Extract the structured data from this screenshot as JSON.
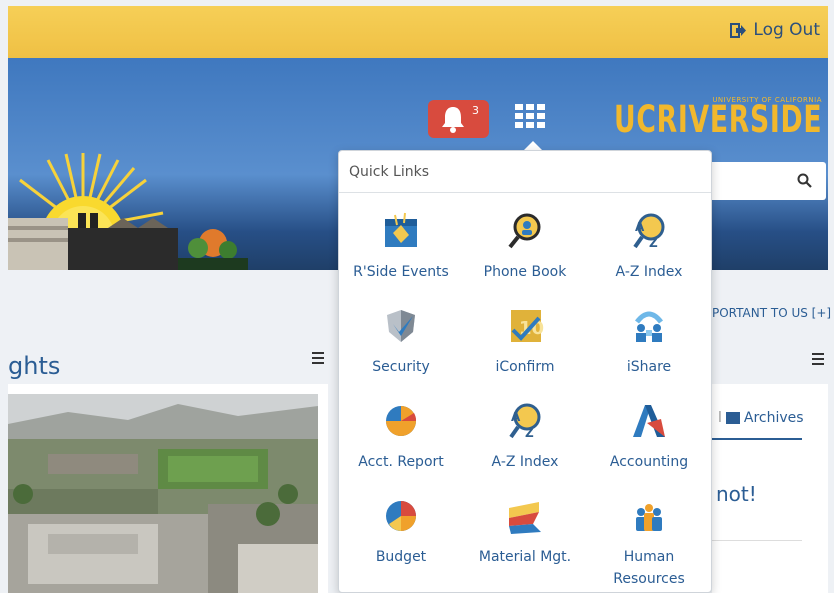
{
  "header": {
    "logout_label": "Log Out",
    "notification_count": "3"
  },
  "logo": {
    "main": "UCRIVERSIDE",
    "sub": "UNIVERSITY OF CALIFORNIA"
  },
  "quick_links": {
    "title": "Quick Links",
    "items": [
      {
        "label": "R'Side Events",
        "icon": "calendar-events-icon"
      },
      {
        "label": "Phone Book",
        "icon": "phone-book-icon"
      },
      {
        "label": "A-Z Index",
        "icon": "az-index-icon"
      },
      {
        "label": "Security",
        "icon": "shield-icon"
      },
      {
        "label": "iConfirm",
        "icon": "iconfirm-icon"
      },
      {
        "label": "iShare",
        "icon": "ishare-icon"
      },
      {
        "label": "Acct. Report",
        "icon": "pie-chart-icon"
      },
      {
        "label": "A-Z Index",
        "icon": "az-index-icon"
      },
      {
        "label": "Accounting",
        "icon": "accounting-icon"
      },
      {
        "label": "Budget",
        "icon": "budget-pie-icon"
      },
      {
        "label": "Material Mgt.",
        "icon": "material-mgt-icon"
      },
      {
        "label": "Human\nResources",
        "icon": "people-icon"
      }
    ]
  },
  "main": {
    "highlights_title": "ghts",
    "important_link": "PORTANT TO US [+]",
    "archives_label": "Archives",
    "archives_prefix": "l",
    "partial_text": "not!"
  },
  "colors": {
    "topbar": "#f3c84f",
    "link_blue": "#2b5d94",
    "alert_red": "#d84b3e",
    "ucr_gold": "#f1b82d"
  }
}
